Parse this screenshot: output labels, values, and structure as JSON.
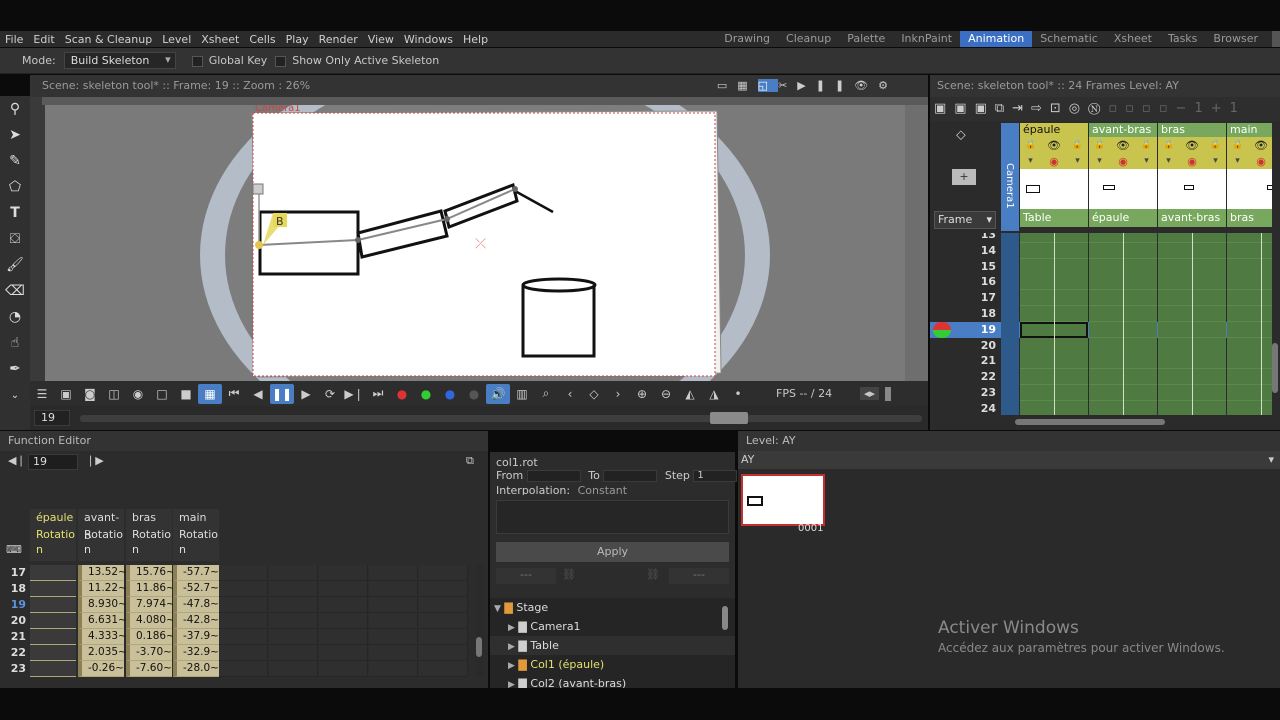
{
  "menu": [
    "File",
    "Edit",
    "Scan & Cleanup",
    "Level",
    "Xsheet",
    "Cells",
    "Play",
    "Render",
    "View",
    "Windows",
    "Help"
  ],
  "rooms": [
    {
      "label": "Drawing",
      "active": false
    },
    {
      "label": "Cleanup",
      "active": false
    },
    {
      "label": "Palette",
      "active": false
    },
    {
      "label": "InknPaint",
      "active": false
    },
    {
      "label": "Animation",
      "active": true
    },
    {
      "label": "Schematic",
      "active": false
    },
    {
      "label": "Xsheet",
      "active": false
    },
    {
      "label": "Tasks",
      "active": false
    },
    {
      "label": "Browser",
      "active": false
    }
  ],
  "tool_options": {
    "mode_label": "Mode:",
    "mode_value": "Build Skeleton",
    "global_key": "Global Key",
    "show_only_active": "Show Only Active Skeleton"
  },
  "viewer": {
    "header": "Scene: skeleton tool*  ::  Frame: 19  ::  Zoom : 26%",
    "camera_label": "Camera1",
    "bone_label": "B",
    "fps": "FPS -- / 24",
    "frame_field": "19"
  },
  "xsheet": {
    "header": "Scene: skeleton tool*  ::  24 Frames  Level: AY",
    "frame_dropdown": "Frame",
    "camera_column": "Camera1",
    "columns": [
      {
        "name": "épaule",
        "parent": "Table",
        "active": true
      },
      {
        "name": "avant-bras",
        "parent": "épaule",
        "active": false
      },
      {
        "name": "bras",
        "parent": "avant-bras",
        "active": false
      },
      {
        "name": "main",
        "parent": "bras",
        "active": false
      }
    ],
    "rows": [
      "13",
      "14",
      "15",
      "16",
      "17",
      "18",
      "19",
      "20",
      "21",
      "22",
      "23",
      "24"
    ],
    "current_row": "19"
  },
  "function_editor": {
    "title": "Function Editor",
    "frame": "19",
    "columns": [
      {
        "name": "épaule",
        "channel": "Rotatio\nn"
      },
      {
        "name": "avant-b",
        "channel": "Rotatio\nn"
      },
      {
        "name": "bras",
        "channel": "Rotatio\nn"
      },
      {
        "name": "main",
        "channel": "Rotatio\nn"
      }
    ],
    "rows": [
      {
        "frame": "17",
        "v": [
          "",
          "13.52~",
          "15.76~",
          "-57.7~"
        ]
      },
      {
        "frame": "18",
        "v": [
          "",
          "11.22~",
          "11.86~",
          "-52.7~"
        ]
      },
      {
        "frame": "19",
        "v": [
          "",
          "8.930~",
          "7.974~",
          "-47.8~"
        ]
      },
      {
        "frame": "20",
        "v": [
          "",
          "6.631~",
          "4.080~",
          "-42.8~"
        ]
      },
      {
        "frame": "21",
        "v": [
          "",
          "4.333~",
          "0.186~",
          "-37.9~"
        ]
      },
      {
        "frame": "22",
        "v": [
          "",
          "2.035~",
          "-3.70~",
          "-32.9~"
        ]
      },
      {
        "frame": "23",
        "v": [
          "",
          "-0.26~",
          "-7.60~",
          "-28.0~"
        ]
      }
    ]
  },
  "segment": {
    "title": "col1.rot",
    "from_label": "From",
    "to_label": "To",
    "step_label": "Step",
    "step_value": "1",
    "interp_label": "Interpolation:",
    "interp_value": "Constant",
    "apply": "Apply",
    "dash": "---"
  },
  "tree": {
    "items": [
      {
        "label": "Stage",
        "level": 0,
        "highlight": false
      },
      {
        "label": "Camera1",
        "level": 1,
        "highlight": false
      },
      {
        "label": "Table",
        "level": 1,
        "highlight": false
      },
      {
        "label": "Col1 (épaule)",
        "level": 1,
        "highlight": true
      },
      {
        "label": "Col2 (avant-bras)",
        "level": 1,
        "highlight": false
      }
    ]
  },
  "level_strip": {
    "title": "Level:  AY",
    "name": "AY",
    "frame": "0001"
  },
  "watermark": {
    "title": "Activer Windows",
    "subtitle": "Accédez aux paramètres pour activer Windows."
  }
}
